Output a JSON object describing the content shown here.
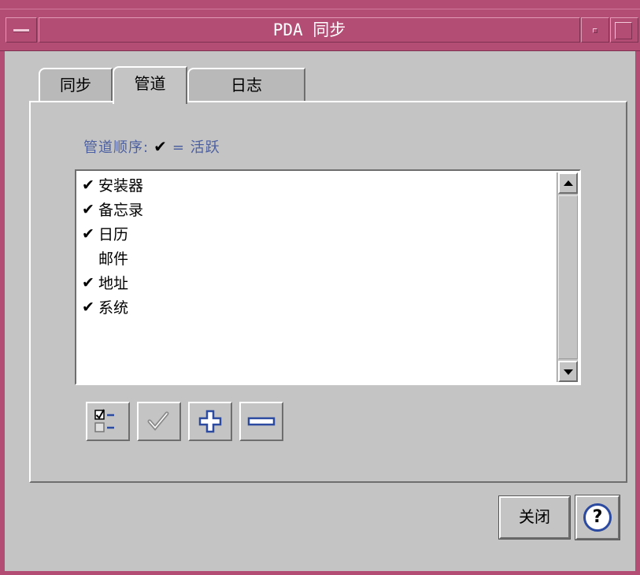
{
  "window": {
    "title": "PDA 同步"
  },
  "tabs": [
    {
      "label": "同步",
      "active": false
    },
    {
      "label": "管道",
      "active": true
    },
    {
      "label": "日志",
      "active": false
    }
  ],
  "conduits": {
    "caption": "管道顺序:",
    "legend_mark": "✔",
    "legend_text": "= 活跃",
    "items": [
      {
        "label": "安装器",
        "active": true,
        "mark": "✔"
      },
      {
        "label": "备忘录",
        "active": true,
        "mark": "✔"
      },
      {
        "label": "日历",
        "active": true,
        "mark": "✔"
      },
      {
        "label": "邮件",
        "active": false,
        "mark": ""
      },
      {
        "label": "地址",
        "active": true,
        "mark": "✔"
      },
      {
        "label": "系统",
        "active": true,
        "mark": "✔"
      }
    ]
  },
  "toolbar": {
    "buttons": [
      {
        "icon": "toggle-all-icon"
      },
      {
        "icon": "check-icon"
      },
      {
        "icon": "plus-icon"
      },
      {
        "icon": "minus-icon"
      }
    ]
  },
  "footer": {
    "close_label": "关闭",
    "help_icon": "help-icon",
    "help_glyph": "?"
  },
  "colors": {
    "titlebar": "#b34d74",
    "caption": "#4c5fa0",
    "window_bg": "#c4c4c4"
  }
}
